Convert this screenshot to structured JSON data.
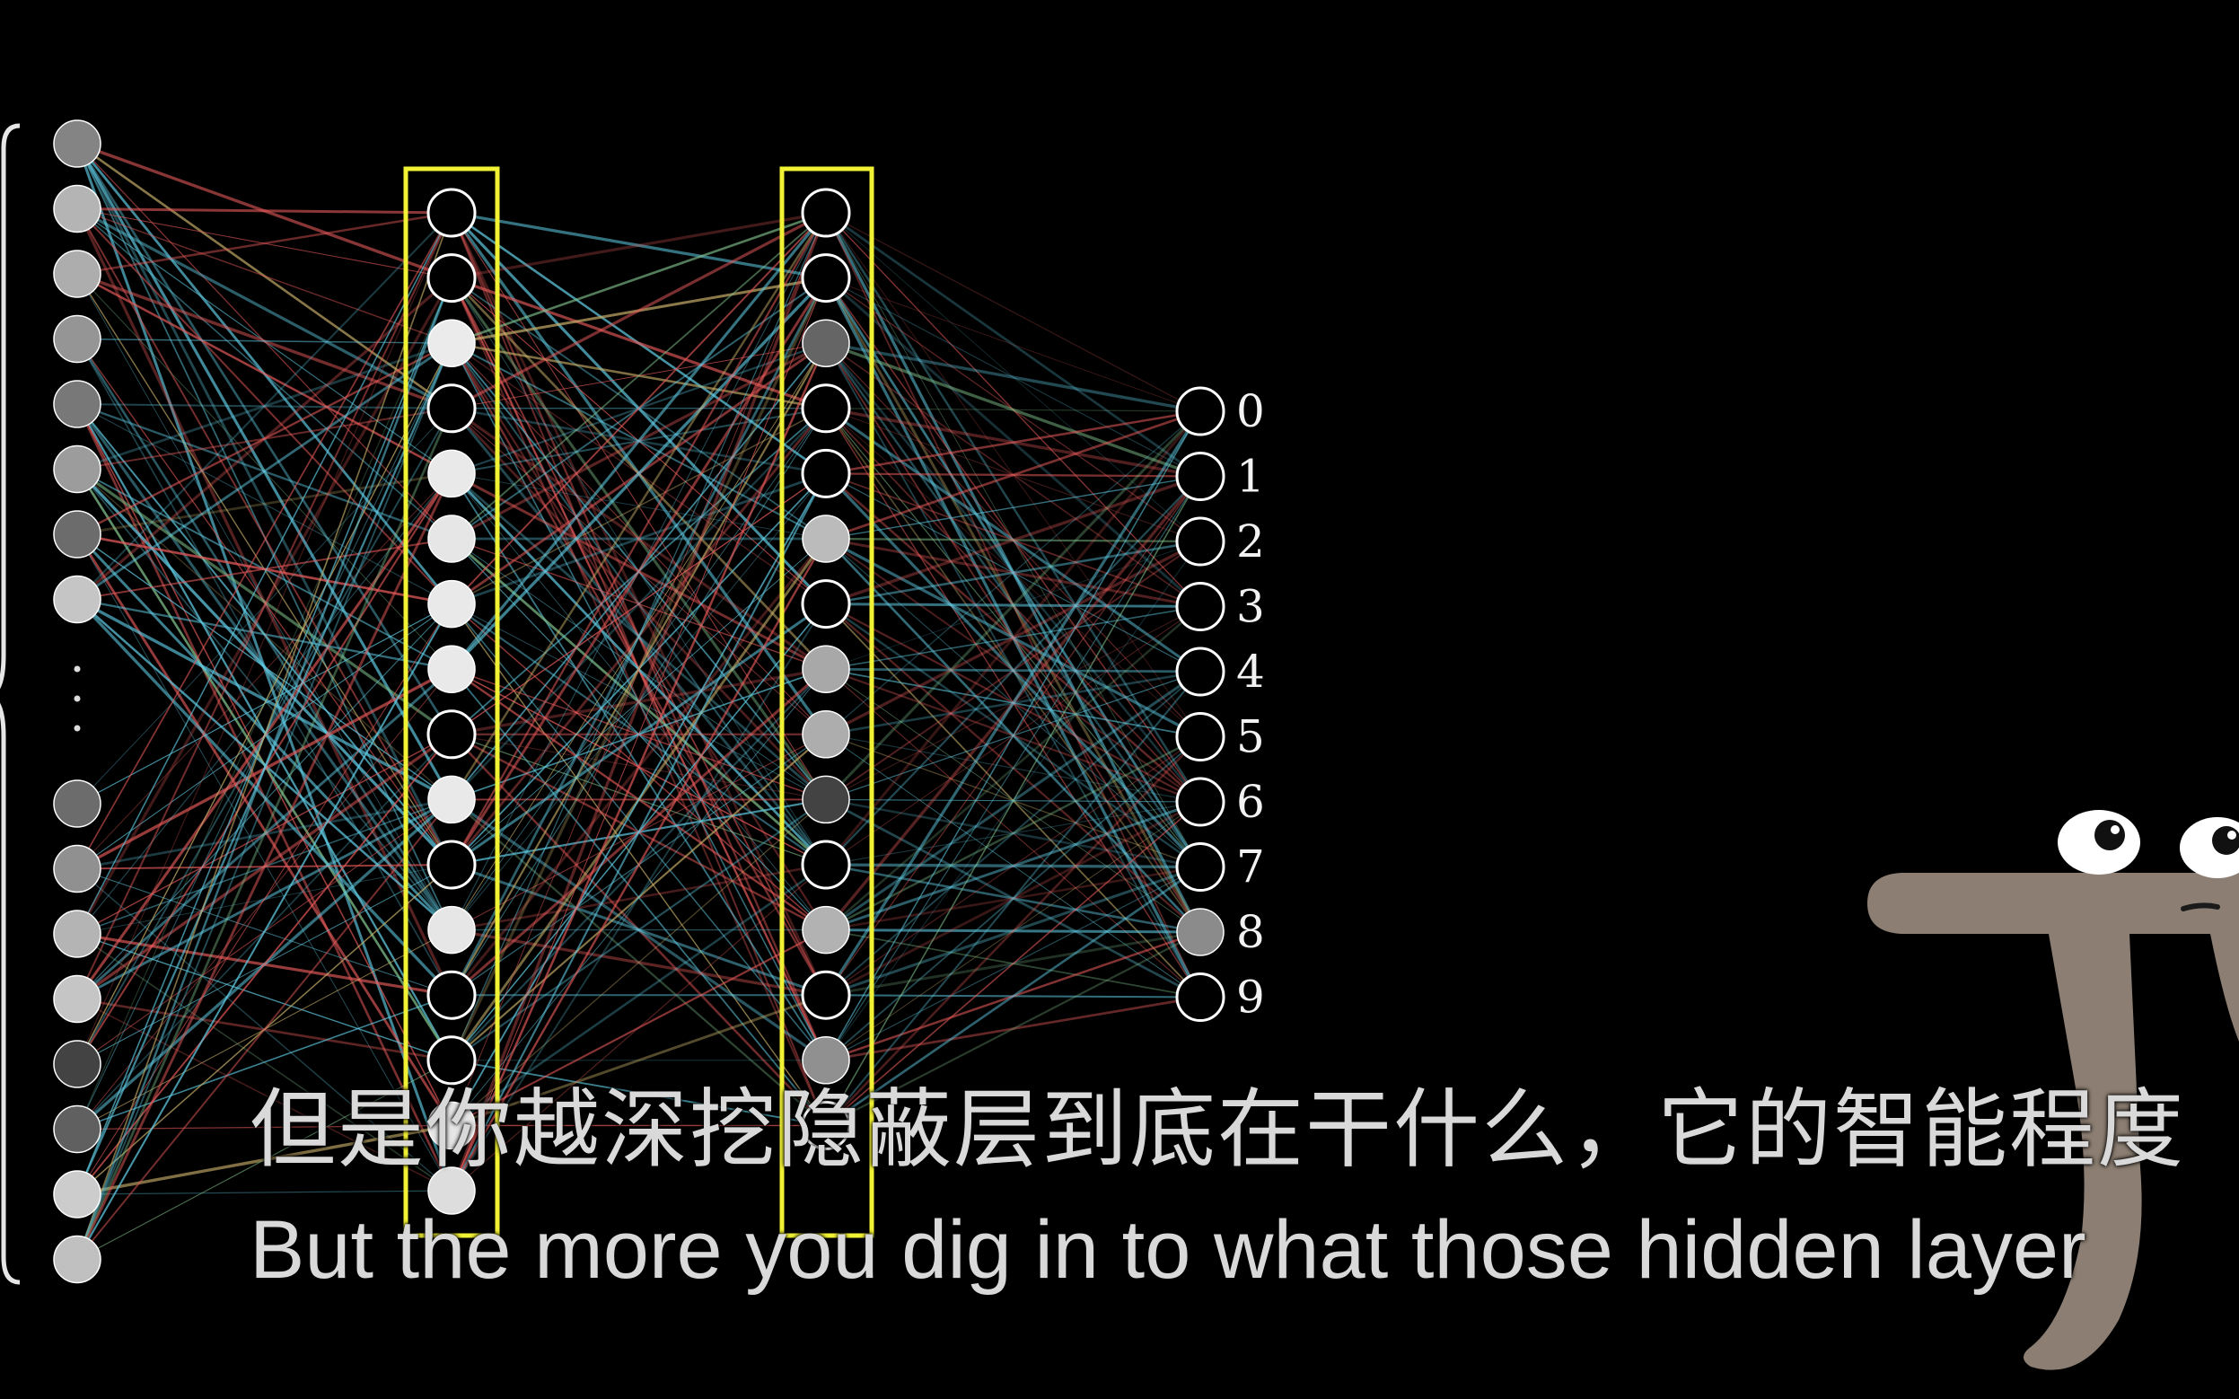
{
  "network": {
    "input_activations_top": [
      0.55,
      0.75,
      0.72,
      0.62,
      0.5,
      0.65,
      0.45,
      0.82
    ],
    "input_activations_bottom": [
      0.45,
      0.6,
      0.75,
      0.82,
      0.28,
      0.4,
      0.85,
      0.8
    ],
    "hidden1_activations": [
      0.0,
      0.0,
      0.98,
      0.0,
      0.97,
      0.96,
      0.97,
      0.97,
      0.0,
      0.97,
      0.0,
      0.96,
      0.0,
      0.0,
      0.96,
      0.92
    ],
    "hidden2_activations": [
      0.0,
      0.0,
      0.42,
      0.0,
      0.0,
      0.78,
      0.0,
      0.7,
      0.72,
      0.28,
      0.0,
      0.74,
      0.0,
      0.6,
      0.0
    ],
    "output_labels": [
      "0",
      "1",
      "2",
      "3",
      "4",
      "5",
      "6",
      "7",
      "8",
      "9"
    ],
    "output_activations": [
      0.0,
      0.0,
      0.0,
      0.0,
      0.0,
      0.0,
      0.0,
      0.0,
      0.58,
      0.0
    ],
    "highlighted_layers": [
      "hidden1",
      "hidden2"
    ],
    "colors": {
      "background": "#000000",
      "highlight_box": "#f2f235",
      "positive_weight": "#5ec8e0",
      "negative_weight": "#e85a5a",
      "neuron_stroke": "#ffffff"
    }
  },
  "subtitles": {
    "zh": "但是你越深挖隐蔽层到底在干什么，它的智能程度",
    "en": "But the more you dig in to what those hidden layer"
  },
  "character": {
    "name": "pi-creature",
    "color": "#8c7e72"
  }
}
